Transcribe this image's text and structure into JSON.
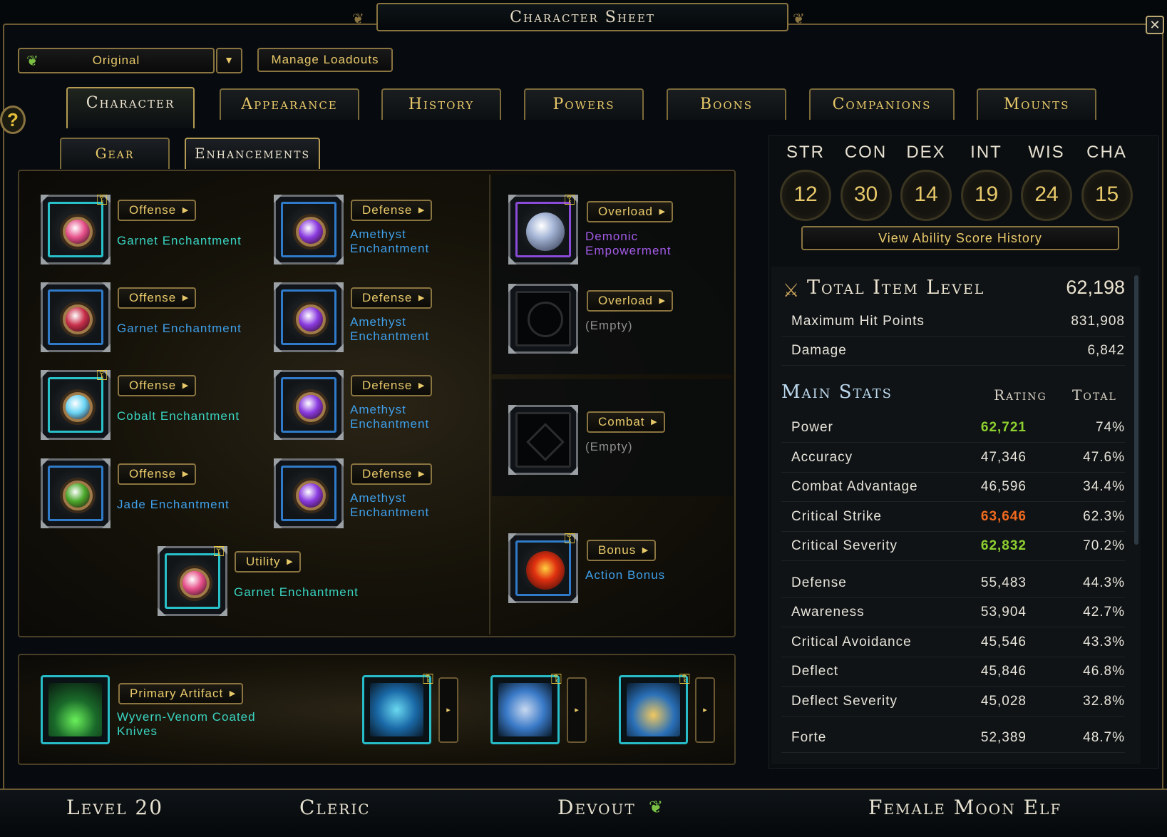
{
  "title": "Character Sheet",
  "close_label": "✕",
  "help_label": "?",
  "loadout": {
    "selected": "Original",
    "manage_label": "Manage Loadouts",
    "dropdown_icon": "chevron-down-icon"
  },
  "tabs": [
    "Character",
    "Appearance",
    "History",
    "Powers",
    "Boons",
    "Companions",
    "Mounts"
  ],
  "active_tab": "Character",
  "subtabs": [
    "Gear",
    "Enhancements"
  ],
  "active_subtab": "Enhancements",
  "enchantments": [
    {
      "slot": "Offense",
      "name": "Garnet Enchantment",
      "color": "teal",
      "gem": "#e6508a",
      "locked": true
    },
    {
      "slot": "Defense",
      "name": "Amethyst Enchantment",
      "color": "blue",
      "gem": "#8a3be0",
      "locked": false
    },
    {
      "slot": "Offense",
      "name": "Garnet Enchantment",
      "color": "blue",
      "gem": "#c8304a",
      "locked": false
    },
    {
      "slot": "Defense",
      "name": "Amethyst Enchantment",
      "color": "blue",
      "gem": "#8a3be0",
      "locked": false
    },
    {
      "slot": "Offense",
      "name": "Cobalt Enchantment",
      "color": "teal",
      "gem": "#6ad4f4",
      "locked": true
    },
    {
      "slot": "Defense",
      "name": "Amethyst Enchantment",
      "color": "blue",
      "gem": "#8a3be0",
      "locked": false
    },
    {
      "slot": "Offense",
      "name": "Jade Enchantment",
      "color": "blue",
      "gem": "#4aa82a",
      "locked": false
    },
    {
      "slot": "Defense",
      "name": "Amethyst Enchantment",
      "color": "blue",
      "gem": "#8a3be0",
      "locked": false
    },
    {
      "slot": "Utility",
      "name": "Garnet Enchantment",
      "color": "teal",
      "gem": "#e6508a",
      "locked": true
    }
  ],
  "special_slots": [
    {
      "slot": "Overload",
      "name": "Demonic Empowerment",
      "color": "purple"
    },
    {
      "slot": "Overload",
      "name": "(Empty)",
      "color": "grey"
    },
    {
      "slot": "Combat",
      "name": "(Empty)",
      "color": "grey"
    },
    {
      "slot": "Bonus",
      "name": "Action Bonus",
      "color": "blue"
    }
  ],
  "artifact": {
    "slot": "Primary Artifact",
    "name": "Wyvern-Venom Coated Knives",
    "side_arrow": "▸"
  },
  "abilities": [
    {
      "name": "STR",
      "value": "12"
    },
    {
      "name": "CON",
      "value": "30"
    },
    {
      "name": "DEX",
      "value": "14"
    },
    {
      "name": "INT",
      "value": "19"
    },
    {
      "name": "WIS",
      "value": "24"
    },
    {
      "name": "CHA",
      "value": "15"
    }
  ],
  "view_history_label": "View Ability Score History",
  "item_level": {
    "label": "Total Item Level",
    "value": "62,198"
  },
  "basic": [
    {
      "label": "Maximum Hit Points",
      "value": "831,908"
    },
    {
      "label": "Damage",
      "value": "6,842"
    }
  ],
  "main_stats": {
    "title": "Main Stats",
    "rating_header": "Rating",
    "total_header": "Total"
  },
  "stats": [
    {
      "label": "Power",
      "rating": "62,721",
      "total": "74%",
      "color": "#8ed02f"
    },
    {
      "label": "Accuracy",
      "rating": "47,346",
      "total": "47.6%",
      "color": "#e8e4da"
    },
    {
      "label": "Combat Advantage",
      "rating": "46,596",
      "total": "34.4%",
      "color": "#e8e4da"
    },
    {
      "label": "Critical Strike",
      "rating": "63,646",
      "total": "62.3%",
      "color": "#f06a1e"
    },
    {
      "label": "Critical Severity",
      "rating": "62,832",
      "total": "70.2%",
      "color": "#8ed02f"
    },
    {
      "label": "Defense",
      "rating": "55,483",
      "total": "44.3%",
      "color": "#e8e4da"
    },
    {
      "label": "Awareness",
      "rating": "53,904",
      "total": "42.7%",
      "color": "#e8e4da"
    },
    {
      "label": "Critical Avoidance",
      "rating": "45,546",
      "total": "43.3%",
      "color": "#e8e4da"
    },
    {
      "label": "Deflect",
      "rating": "45,846",
      "total": "46.8%",
      "color": "#e8e4da"
    },
    {
      "label": "Deflect Severity",
      "rating": "45,028",
      "total": "32.8%",
      "color": "#e8e4da"
    },
    {
      "label": "Forte",
      "rating": "52,389",
      "total": "48.7%",
      "color": "#e8e4da"
    }
  ],
  "footer": {
    "level": "Level 20",
    "class": "Cleric",
    "paragon": "Devout",
    "race": "Female Moon Elf"
  }
}
